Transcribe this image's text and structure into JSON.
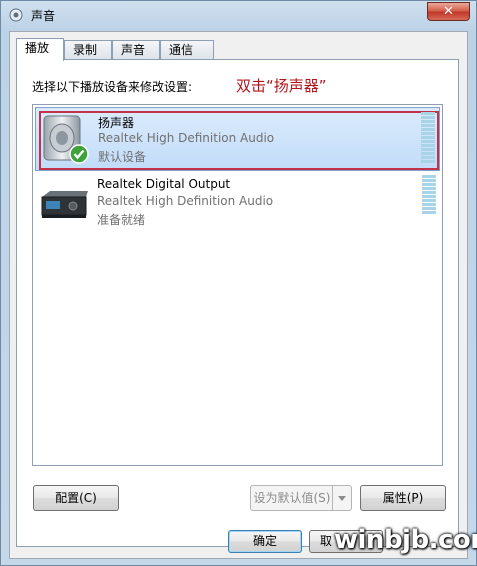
{
  "window": {
    "title": "声音",
    "close_label": "✕"
  },
  "tabs": [
    {
      "label": "播放",
      "active": true
    },
    {
      "label": "录制",
      "active": false
    },
    {
      "label": "声音",
      "active": false
    },
    {
      "label": "通信",
      "active": false
    }
  ],
  "playback": {
    "instruction": "选择以下播放设备来修改设置:",
    "annotation": "双击“扬声器”",
    "devices": [
      {
        "name": "扬声器",
        "description": "Realtek High Definition Audio",
        "status": "默认设备",
        "icon": "speaker-icon",
        "selected": true,
        "is_default": true
      },
      {
        "name": "Realtek Digital Output",
        "description": "Realtek High Definition Audio",
        "status": "准备就绪",
        "icon": "digital-output-icon",
        "selected": false,
        "is_default": false
      }
    ]
  },
  "buttons": {
    "configure": "配置(C)",
    "set_default": "设为默认值(S)",
    "properties": "属性(P)",
    "ok": "确定",
    "cancel": "取"
  },
  "watermark": "winbjb.com",
  "colors": {
    "annotation": "#b3141b",
    "highlight_border": "#c2334a",
    "selection": "#c1dcf9",
    "meter": "#a9d4e8"
  }
}
